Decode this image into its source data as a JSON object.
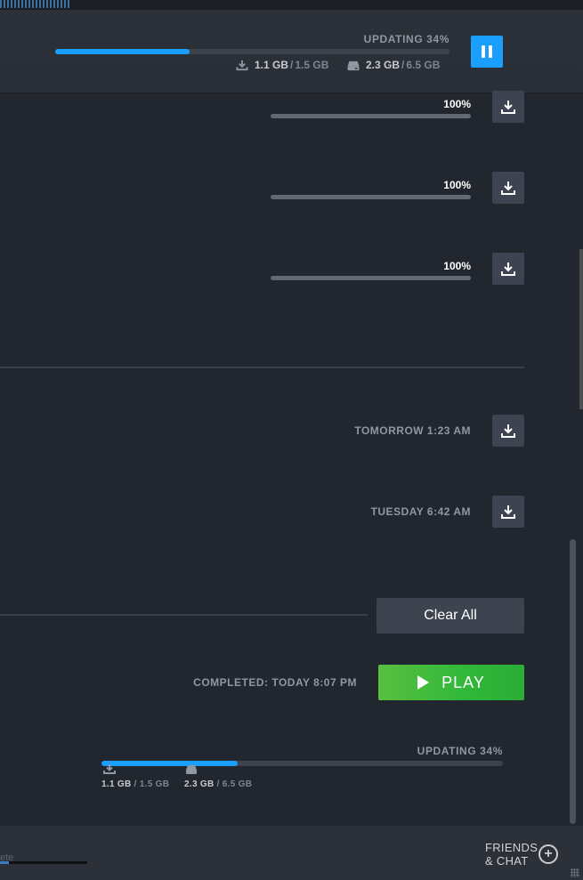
{
  "header": {
    "status": "UPDATING 34%",
    "progress_fraction": 0.34,
    "download_current": "1.1 GB",
    "download_total": "1.5 GB",
    "disk_current": "2.3 GB",
    "disk_total": "6.5 GB",
    "separator": "/"
  },
  "queue": {
    "items": [
      {
        "percent": "100%",
        "progress_fraction": 1.0
      },
      {
        "percent": "100%",
        "progress_fraction": 1.0
      },
      {
        "percent": "100%",
        "progress_fraction": 1.0
      }
    ]
  },
  "scheduled": {
    "items": [
      {
        "time": "TOMORROW 1:23 AM"
      },
      {
        "time": "TUESDAY 6:42 AM"
      }
    ]
  },
  "completed": {
    "clear_all_label": "Clear All",
    "completed_text": "COMPLETED: TODAY 8:07 PM",
    "play_label": "PLAY",
    "status": "UPDATING 34%",
    "progress_fraction": 0.34,
    "download_current": "1.1 GB",
    "download_total": "1.5 GB",
    "disk_current": "2.3 GB",
    "disk_total": "6.5 GB",
    "separator": "/"
  },
  "footer": {
    "input_fragment": "ete",
    "friends_line1": "FRIENDS",
    "friends_line2": "& CHAT",
    "friends_plus": "+"
  },
  "colors": {
    "accent_blue": "#1a9fff",
    "play_green": "#5ba32b",
    "background": "#22262e"
  }
}
